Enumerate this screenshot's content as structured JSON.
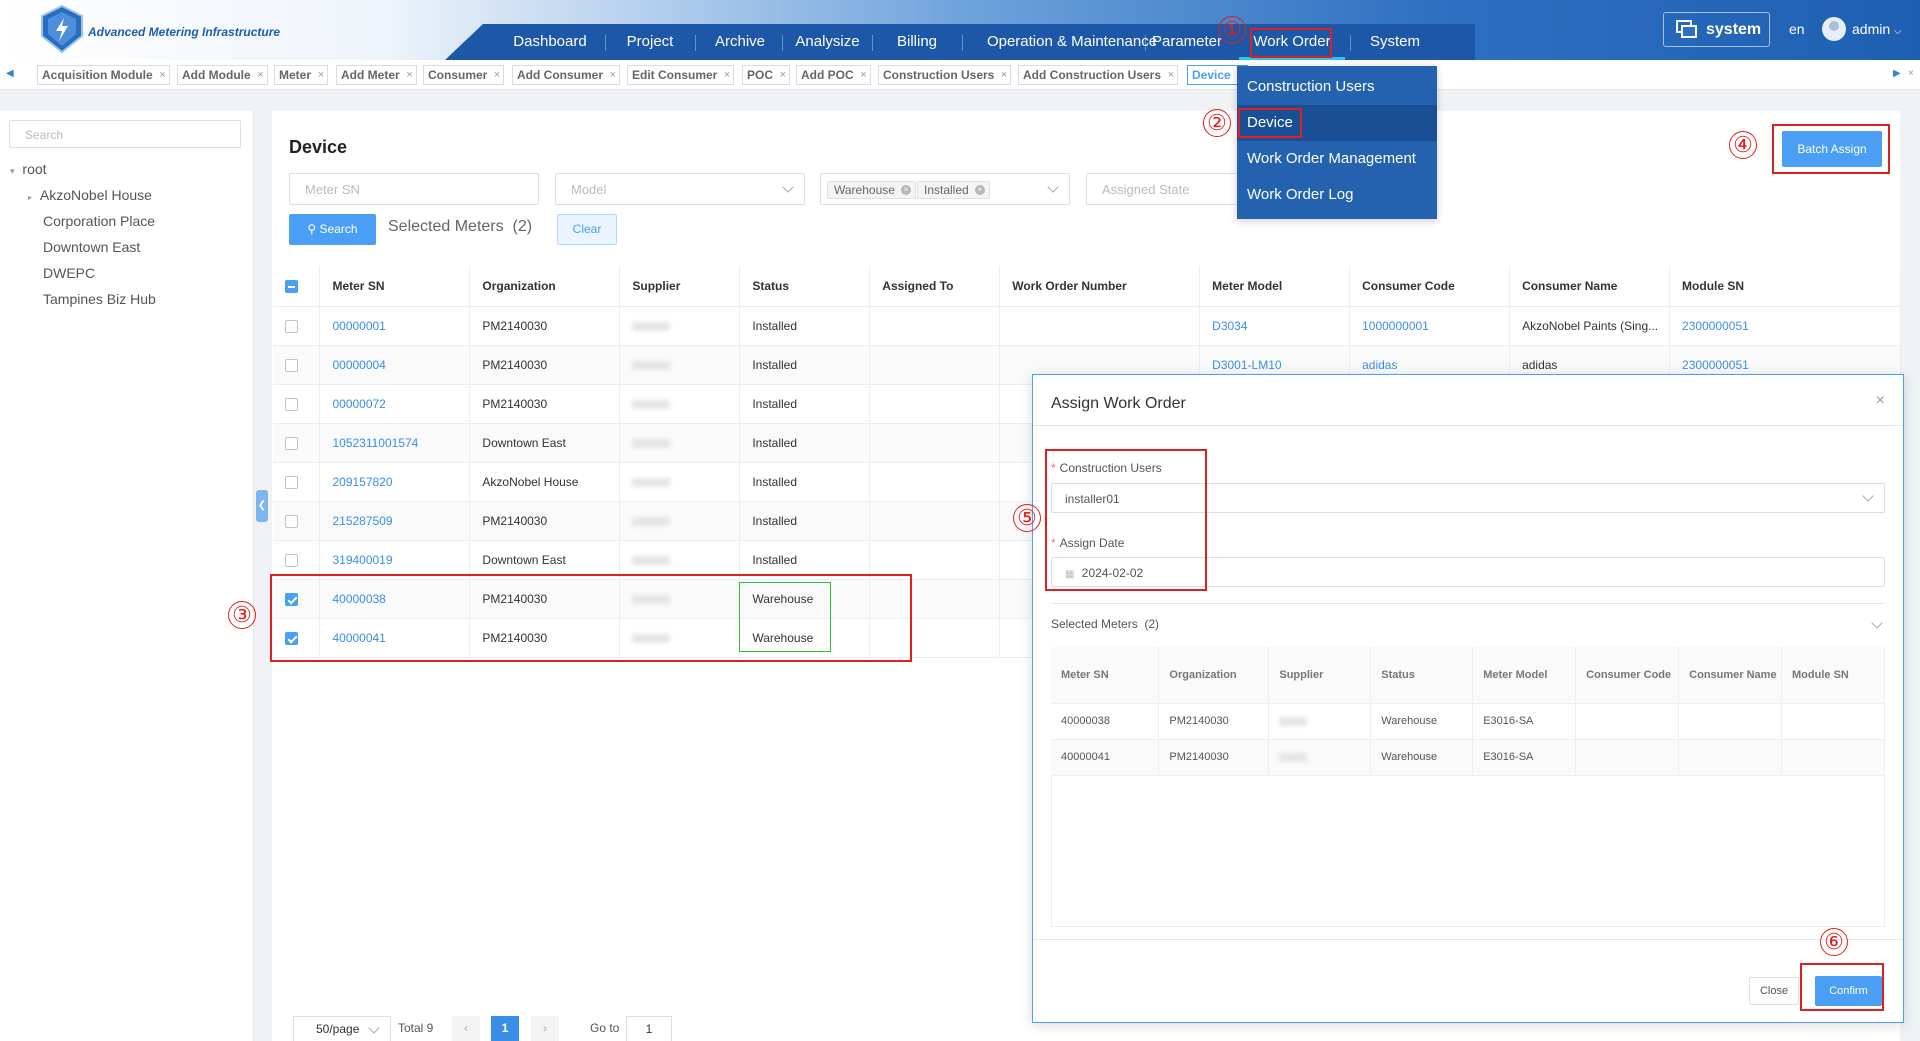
{
  "app": {
    "brand": "Advanced Metering Infrastructure"
  },
  "nav": {
    "items": [
      "Dashboard",
      "Project",
      "Archive",
      "Analysize",
      "Billing",
      "Operation & Maintenance",
      "Parameter",
      "Work Order",
      "System"
    ],
    "system_button": "system",
    "lang": "en",
    "user": "admin"
  },
  "tabs": [
    "Acquisition Module",
    "Add Module",
    "Meter",
    "Add Meter",
    "Consumer",
    "Add Consumer",
    "Edit Consumer",
    "POC",
    "Add POC",
    "Construction Users",
    "Add Construction Users",
    "Device"
  ],
  "sidebar": {
    "search_placeholder": "Search",
    "root": "root",
    "items": [
      "AkzoNobel House",
      "Corporation Place",
      "Downtown East",
      "DWEPC",
      "Tampines Biz Hub"
    ]
  },
  "page": {
    "title": "Device",
    "meter_sn_placeholder": "Meter SN",
    "model_placeholder": "Model",
    "status_chips": [
      "Warehouse",
      "Installed"
    ],
    "assigned_state_placeholder": "Assigned State",
    "search_label": "Search",
    "selected_label": "Selected Meters",
    "selected_count": "(2)",
    "clear_label": "Clear",
    "batch_assign_label": "Batch Assign"
  },
  "table": {
    "headers": [
      "Meter SN",
      "Organization",
      "Supplier",
      "Status",
      "Assigned To",
      "Work Order Number",
      "Meter Model",
      "Consumer Code",
      "Consumer Name",
      "Module SN"
    ],
    "rows": [
      {
        "sn": "00000001",
        "org": "PM2140030",
        "status": "Installed",
        "model": "D3034",
        "code": "1000000001",
        "name": "AkzoNobel Paints (Sing...",
        "module": "2300000051",
        "checked": false
      },
      {
        "sn": "00000004",
        "org": "PM2140030",
        "status": "Installed",
        "model": "D3001-LM10",
        "code": "adidas",
        "name": "adidas",
        "module": "2300000051",
        "checked": false
      },
      {
        "sn": "00000072",
        "org": "PM2140030",
        "status": "Installed",
        "model": "",
        "code": "",
        "name": "",
        "module": "",
        "checked": false
      },
      {
        "sn": "1052311001574",
        "org": "Downtown East",
        "status": "Installed",
        "model": "",
        "code": "",
        "name": "",
        "module": "",
        "checked": false
      },
      {
        "sn": "209157820",
        "org": "AkzoNobel House",
        "status": "Installed",
        "model": "",
        "code": "",
        "name": "",
        "module": "",
        "checked": false
      },
      {
        "sn": "215287509",
        "org": "PM2140030",
        "status": "Installed",
        "model": "",
        "code": "",
        "name": "",
        "module": "",
        "checked": false
      },
      {
        "sn": "319400019",
        "org": "Downtown East",
        "status": "Installed",
        "model": "",
        "code": "",
        "name": "",
        "module": "",
        "checked": false
      },
      {
        "sn": "40000038",
        "org": "PM2140030",
        "status": "Warehouse",
        "model": "",
        "code": "",
        "name": "",
        "module": "",
        "checked": true
      },
      {
        "sn": "40000041",
        "org": "PM2140030",
        "status": "Warehouse",
        "model": "",
        "code": "",
        "name": "",
        "module": "",
        "checked": true
      }
    ]
  },
  "pagination": {
    "per_page": "50/page",
    "total": "Total 9",
    "current": "1",
    "goto_label": "Go to",
    "goto_value": "1"
  },
  "dropdown": {
    "items": [
      "Construction Users",
      "Device",
      "Work Order Management",
      "Work Order Log"
    ],
    "active": "Device"
  },
  "modal": {
    "title": "Assign Work Order",
    "construction_users_label": "Construction Users",
    "construction_users_value": "installer01",
    "assign_date_label": "Assign Date",
    "assign_date_value": "2024-02-02",
    "selected_label": "Selected Meters",
    "selected_count": "(2)",
    "headers": [
      "Meter SN",
      "Organization",
      "Supplier",
      "Status",
      "Meter Model",
      "Consumer Code",
      "Consumer Name",
      "Module SN"
    ],
    "rows": [
      {
        "sn": "40000038",
        "org": "PM2140030",
        "status": "Warehouse",
        "model": "E3016-SA"
      },
      {
        "sn": "40000041",
        "org": "PM2140030",
        "status": "Warehouse",
        "model": "E3016-SA"
      }
    ],
    "close_label": "Close",
    "confirm_label": "Confirm"
  },
  "annotations": {
    "steps": [
      "①",
      "②",
      "③",
      "④",
      "⑤",
      "⑥"
    ],
    "color": "#e02020"
  }
}
